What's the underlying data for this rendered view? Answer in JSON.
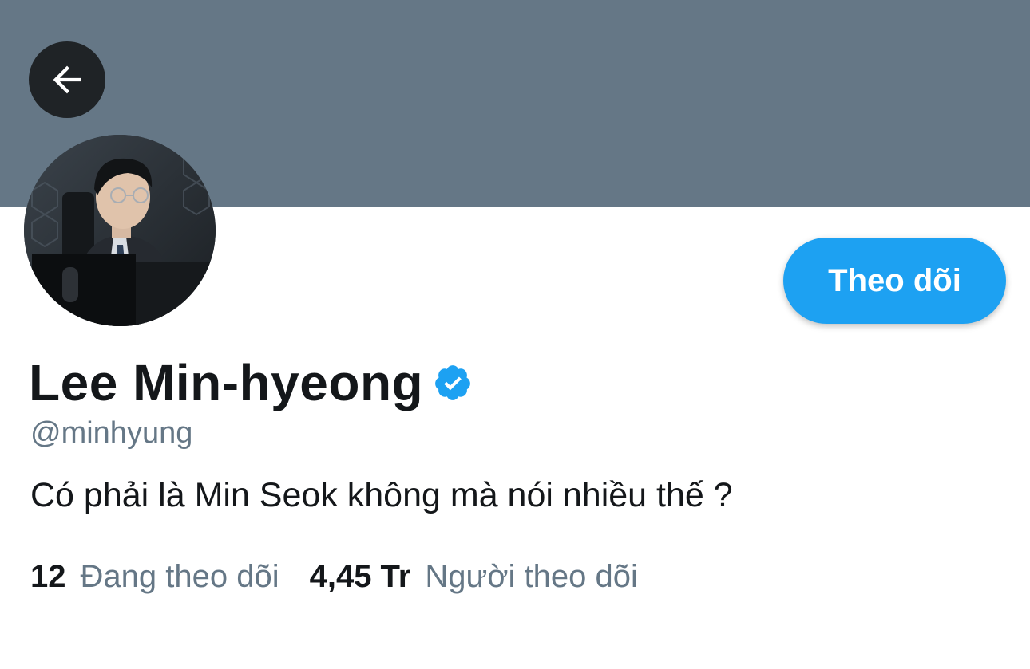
{
  "header": {
    "back_icon": "arrow-left-icon",
    "banner_color": "#657786"
  },
  "profile": {
    "display_name": "Lee Min-hyeong",
    "verified_icon": "verified-badge-icon",
    "handle": "@minhyung",
    "bio": "Có phải là Min Seok không mà nói nhiều thế ?",
    "follow_label": "Theo dõi",
    "accent_color": "#1da1f2"
  },
  "stats": {
    "following_count": "12",
    "following_label": "Đang theo dõi",
    "followers_count": "4,45 Tr",
    "followers_label": "Người theo dõi"
  }
}
